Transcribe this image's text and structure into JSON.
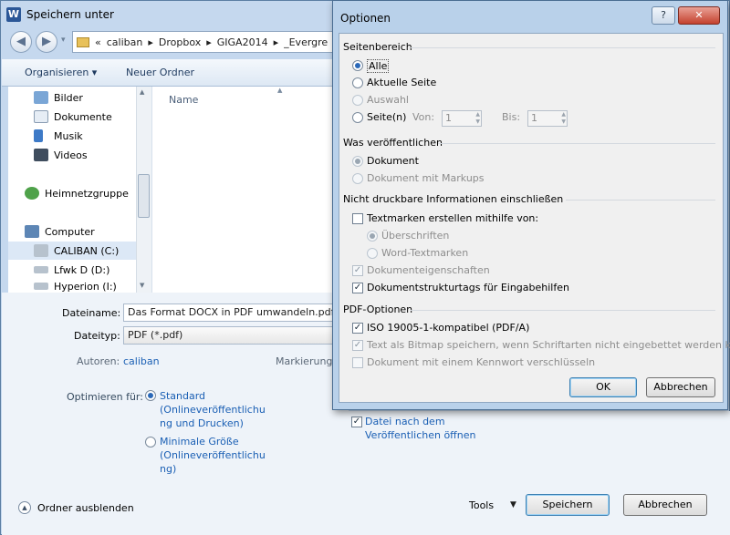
{
  "main": {
    "title": "Speichern unter",
    "address": {
      "prefix": "«",
      "parts": [
        "caliban",
        "Dropbox",
        "GIGA2014",
        "_Evergre"
      ]
    },
    "toolbar": {
      "organize": "Organisieren ▾",
      "new_folder": "Neuer Ordner"
    },
    "nav_items": [
      "Bilder",
      "Dokumente",
      "Musik",
      "Videos",
      "Heimnetzgruppe",
      "Computer",
      "CALIBAN (C:)",
      "Lfwk D (D:)",
      "Hyperion (I:)"
    ],
    "column_name": "Name",
    "form": {
      "filename_label": "Dateiname:",
      "filename_value": "Das Format DOCX in PDF umwandeln.pdf",
      "filetype_label": "Dateityp:",
      "filetype_value": "PDF (*.pdf)",
      "authors_label": "Autoren:",
      "authors_value": "caliban",
      "tags_label": "Markierung",
      "optimize_label": "Optimieren für:",
      "opt_standard": [
        "Standard",
        "(Onlineveröffentlichu",
        "ng und Drucken)"
      ],
      "opt_minimal": [
        "Minimale Größe",
        "(Onlineveröffentlichu",
        "ng)"
      ],
      "open_after": [
        "Datei nach dem",
        "Veröffentlichen öffnen"
      ]
    },
    "bottom": {
      "hide_folders": "Ordner ausblenden",
      "tools": "Tools",
      "save": "Speichern",
      "cancel": "Abbrechen"
    }
  },
  "dialog": {
    "title": "Optionen",
    "help": "?",
    "close": "✕",
    "range": {
      "header": "Seitenbereich",
      "all": "Alle",
      "current": "Aktuelle Seite",
      "selection": "Auswahl",
      "pages": "Seite(n)",
      "from_label": "Von:",
      "from_value": "1",
      "to_label": "Bis:",
      "to_value": "1"
    },
    "publish": {
      "header": "Was veröffentlichen",
      "document": "Dokument",
      "document_markup": "Dokument mit Markups"
    },
    "nonprint": {
      "header": "Nicht druckbare Informationen einschließen",
      "bookmarks": "Textmarken erstellen mithilfe von:",
      "headings": "Überschriften",
      "word_bookmarks": "Word-Textmarken",
      "properties": "Dokumenteigenschaften",
      "structure_tags": "Dokumentstrukturtags für Eingabehilfen"
    },
    "pdf": {
      "header": "PDF-Optionen",
      "iso": "ISO 19005-1-kompatibel (PDF/A)",
      "bitmap": "Text als Bitmap speichern, wenn Schriftarten nicht eingebettet werden können",
      "encrypt": "Dokument mit einem Kennwort verschlüsseln"
    },
    "ok": "OK",
    "cancel": "Abbrechen"
  },
  "colors": {
    "accent": "#2a68b8",
    "link": "#1a5fb4",
    "chrome": "#c5d8ee"
  }
}
